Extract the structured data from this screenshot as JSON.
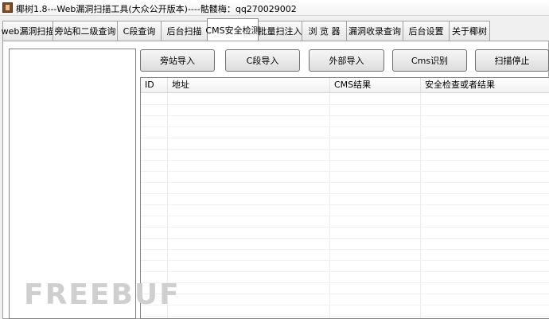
{
  "window": {
    "title": "椰树1.8---Web漏洞扫描工具(大众公开版本)----骷髅梅：qq270029002"
  },
  "tabs": [
    {
      "label": "web漏洞扫描",
      "active": false
    },
    {
      "label": "旁站和二级查询",
      "active": false
    },
    {
      "label": "C段查询",
      "active": false
    },
    {
      "label": "后台扫描",
      "active": false
    },
    {
      "label": "CMS安全检测",
      "active": true
    },
    {
      "label": "批量扫注入",
      "active": false
    },
    {
      "label": "浏 览 器",
      "active": false
    },
    {
      "label": "漏洞收录查询",
      "active": false
    },
    {
      "label": "后台设置",
      "active": false
    },
    {
      "label": "关于椰树",
      "active": false
    }
  ],
  "buttons": {
    "import_side": "旁站导入",
    "import_c": "C段导入",
    "import_external": "外部导入",
    "cms_identify": "Cms识别",
    "stop_scan": "扫描停止"
  },
  "table": {
    "columns": [
      "ID",
      "地址",
      "CMS结果",
      "安全检查或者结果"
    ],
    "rows": []
  },
  "watermark": "FREEBUF"
}
